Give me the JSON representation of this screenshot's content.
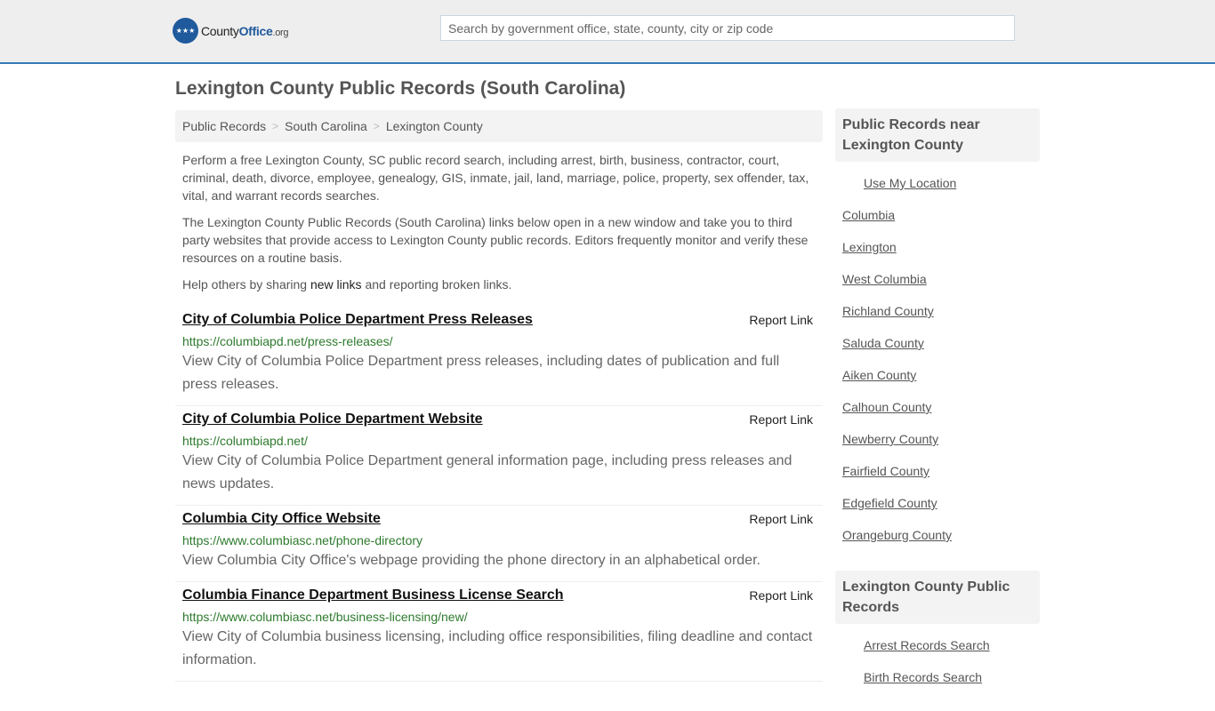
{
  "header": {
    "logo": {
      "county": "County",
      "office": "Office",
      "org": ".org",
      "icon": "eagle-stars-badge-icon"
    },
    "search_placeholder": "Search by government office, state, county, city or zip code",
    "accent_color": "#337ab7"
  },
  "page": {
    "title": "Lexington County Public Records (South Carolina)"
  },
  "breadcrumb": [
    {
      "label": "Public Records"
    },
    {
      "label": "South Carolina"
    },
    {
      "label": "Lexington County"
    }
  ],
  "breadcrumb_separator": ">",
  "intro": {
    "p1": "Perform a free Lexington County, SC public record search, including arrest, birth, business, contractor, court, criminal, death, divorce, employee, genealogy, GIS, inmate, jail, land, marriage, police, property, sex offender, tax, vital, and warrant records searches.",
    "p2": "The Lexington County Public Records (South Carolina) links below open in a new window and take you to third party websites that provide access to Lexington County public records. Editors frequently monitor and verify these resources on a routine basis.",
    "p3_before": "Help others by sharing ",
    "p3_link": "new links",
    "p3_after": " and reporting broken links."
  },
  "report_label": "Report Link",
  "results": [
    {
      "title": "City of Columbia Police Department Press Releases",
      "url": "https://columbiapd.net/press-releases/",
      "desc": "View City of Columbia Police Department press releases, including dates of publication and full press releases."
    },
    {
      "title": "City of Columbia Police Department Website",
      "url": "https://columbiapd.net/",
      "desc": "View City of Columbia Police Department general information page, including press releases and news updates."
    },
    {
      "title": "Columbia City Office Website",
      "url": "https://www.columbiasc.net/phone-directory",
      "desc": "View Columbia City Office's webpage providing the phone directory in an alphabetical order."
    },
    {
      "title": "Columbia Finance Department Business License Search",
      "url": "https://www.columbiasc.net/business-licensing/new/",
      "desc": "View City of Columbia business licensing, including office responsibilities, filing deadline and contact information."
    }
  ],
  "sidebar": {
    "near_title": "Public Records near Lexington County",
    "use_location": "Use My Location",
    "near_links": [
      "Columbia",
      "Lexington",
      "West Columbia",
      "Richland County",
      "Saluda County",
      "Aiken County",
      "Calhoun County",
      "Newberry County",
      "Fairfield County",
      "Edgefield County",
      "Orangeburg County"
    ],
    "records_title": "Lexington County Public Records",
    "records_links": [
      "Arrest Records Search",
      "Birth Records Search"
    ]
  }
}
